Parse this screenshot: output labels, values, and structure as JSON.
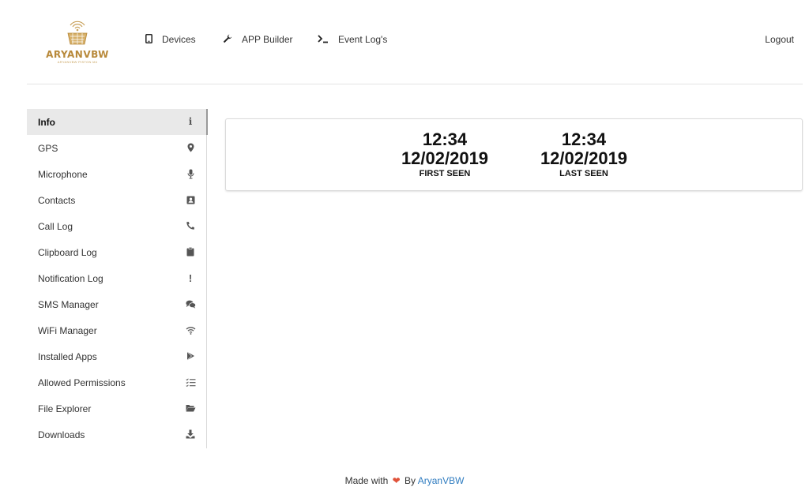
{
  "brand": {
    "name": "ARYANVBW",
    "tagline": "ARYANVBW PISTON M4"
  },
  "nav": {
    "devices": "Devices",
    "app_builder": "APP Builder",
    "event_log": "Event Log's",
    "logout": "Logout"
  },
  "sidebar": {
    "items": [
      {
        "label": "Info",
        "icon": "info-icon"
      },
      {
        "label": "GPS",
        "icon": "map-marker-icon"
      },
      {
        "label": "Microphone",
        "icon": "microphone-icon"
      },
      {
        "label": "Contacts",
        "icon": "contact-card-icon"
      },
      {
        "label": "Call Log",
        "icon": "phone-icon"
      },
      {
        "label": "Clipboard Log",
        "icon": "clipboard-icon"
      },
      {
        "label": "Notification Log",
        "icon": "exclamation-icon"
      },
      {
        "label": "SMS Manager",
        "icon": "chat-icon"
      },
      {
        "label": "WiFi Manager",
        "icon": "wifi-icon"
      },
      {
        "label": "Installed Apps",
        "icon": "play-store-icon"
      },
      {
        "label": "Allowed Permissions",
        "icon": "checklist-icon"
      },
      {
        "label": "File Explorer",
        "icon": "folder-open-icon"
      },
      {
        "label": "Downloads",
        "icon": "download-icon"
      }
    ]
  },
  "info": {
    "first_seen": {
      "time": "12:34",
      "date": "12/02/2019",
      "label": "FIRST SEEN"
    },
    "last_seen": {
      "time": "12:34",
      "date": "12/02/2019",
      "label": "LAST SEEN"
    }
  },
  "footer": {
    "made_with": "Made with",
    "by": "By",
    "author": "AryanVBW"
  },
  "colors": {
    "brand_gold": "#b8893a",
    "active_bg": "#e9e9e9",
    "link_blue": "#2f7cc0",
    "heart_red": "#e0523a"
  }
}
